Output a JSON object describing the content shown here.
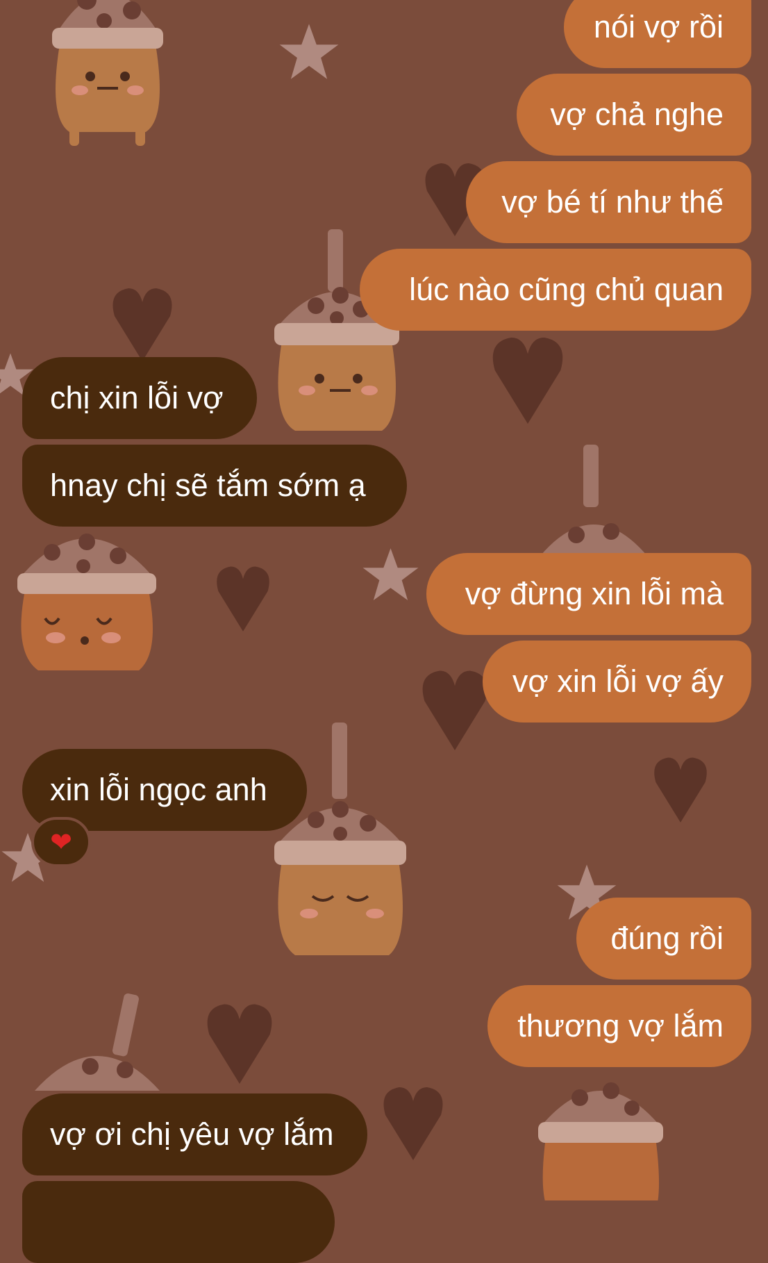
{
  "messages": {
    "m1": "nói vợ rồi",
    "m2": "vợ chả nghe",
    "m3": "vợ bé tí như thế",
    "m4": "lúc nào cũng chủ quan",
    "m5": "chị xin lỗi vợ",
    "m6": "hnay chị sẽ tắm sớm ạ",
    "m7": "vợ đừng xin lỗi mà",
    "m8": "vợ xin lỗi vợ ấy",
    "m9": "xin lỗi ngọc anh",
    "m10": "đúng rồi",
    "m11": "thương vợ lắm",
    "m12": "vợ ơi chị yêu vợ lắm"
  },
  "reaction": {
    "emoji": "❤"
  },
  "colors": {
    "outgoing_bubble": "#c47038",
    "incoming_bubble": "#4a2a0d",
    "background": "#7b4c3b"
  }
}
